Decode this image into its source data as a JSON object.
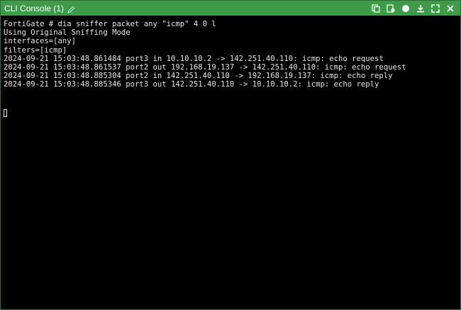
{
  "window": {
    "title": "CLI Console (1)"
  },
  "icons": {
    "edit": "pencil-icon",
    "actions": [
      "copy-icon",
      "clear-icon",
      "record-icon",
      "download-icon",
      "expand-icon",
      "close-icon"
    ]
  },
  "colors": {
    "titlebar": "#3f9a49",
    "terminal_bg": "#000000",
    "terminal_fg": "#e6e6e6"
  },
  "terminal": {
    "lines": [
      "FortiGate # dia sniffer packet any \"icmp\" 4 0 l",
      "Using Original Sniffing Mode",
      "interfaces=[any]",
      "filters=[icmp]",
      "2024-09-21 15:03:48.861484 port3 in 10.10.10.2 -> 142.251.40.110: icmp: echo request",
      "2024-09-21 15:03:48.861537 port2 out 192.168.19.137 -> 142.251.40.110: icmp: echo request",
      "2024-09-21 15:03:48.885304 port2 in 142.251.40.110 -> 192.168.19.137: icmp: echo reply",
      "2024-09-21 15:03:48.885346 port3 out 142.251.40.110 -> 10.10.10.2: icmp: echo reply"
    ]
  }
}
